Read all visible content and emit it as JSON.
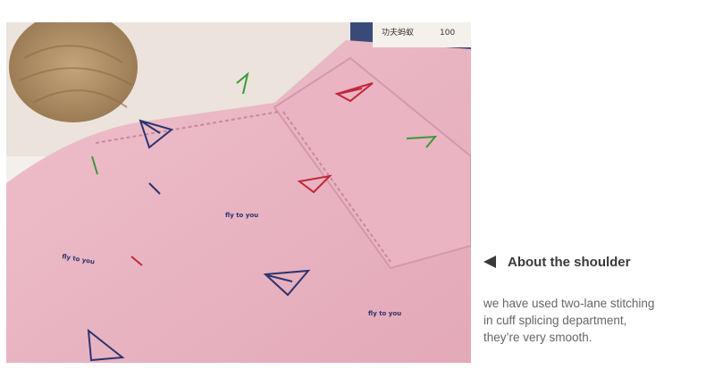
{
  "photo": {
    "label_text": "功夫蚂蚁",
    "label_number": "100",
    "print_text_1": "fly to you",
    "print_text_2": "fly to you",
    "print_text_3": "fly to you"
  },
  "caption": {
    "arrow_icon": "triangle-left",
    "heading": "About the shoulder",
    "lines": [
      "we have used two-lane stitching",
      "in cuff splicing department,",
      "they’re very smooth."
    ]
  },
  "colors": {
    "shirt_pink": "#e9b6c4",
    "heading": "#3a3a3a",
    "body": "#666666"
  }
}
